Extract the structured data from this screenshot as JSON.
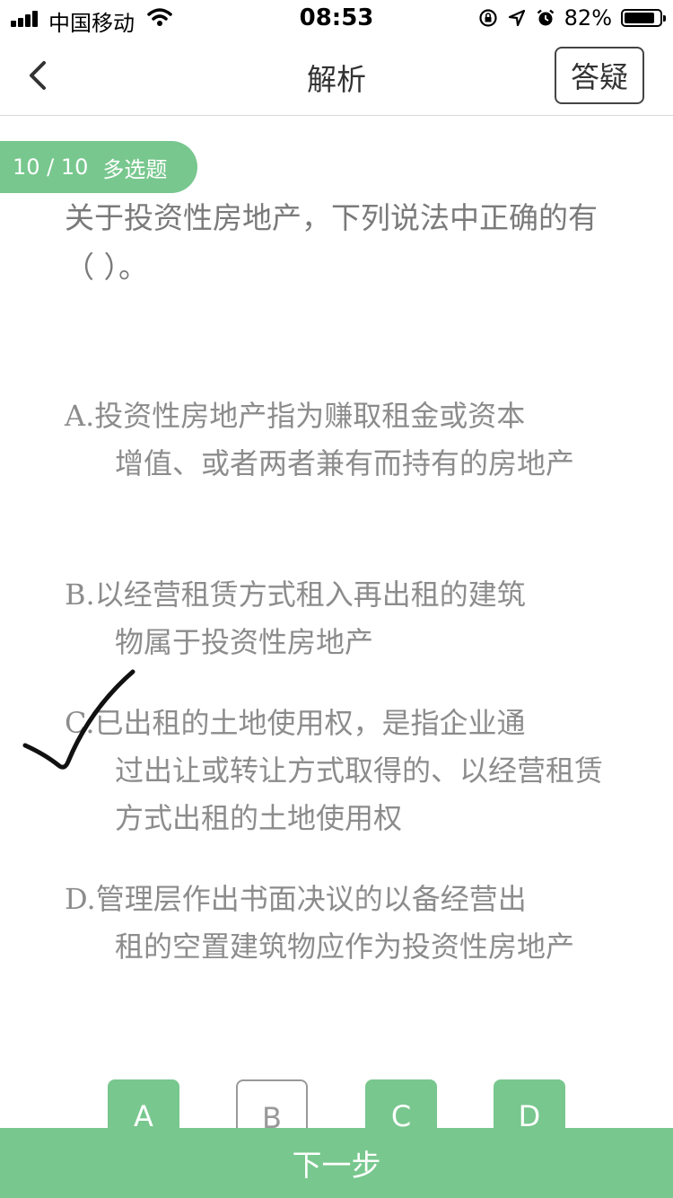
{
  "status_bar": {
    "carrier": "中国移动",
    "time": "08:53",
    "battery_percent": "82%",
    "battery_level": 0.82,
    "icons": [
      "signal-icon",
      "wifi-icon",
      "rotation-lock-icon",
      "location-icon",
      "alarm-icon",
      "battery-icon"
    ]
  },
  "nav": {
    "title": "解析",
    "ask_button": "答疑",
    "back_icon": "chevron-left-icon"
  },
  "question": {
    "progress": "10 / 10",
    "type": "多选题",
    "text": "关于投资性房地产，下列说法中正确的有（ ）。"
  },
  "options": [
    {
      "letter": "A.",
      "line1": "投资性房地产指为赚取租金或资本",
      "rest": "增值、或者两者兼有而持有的房地产"
    },
    {
      "letter": "B.",
      "line1": "以经营租赁方式租入再出租的建筑",
      "rest": "物属于投资性房地产"
    },
    {
      "letter": "C.",
      "line1": "已出租的土地使用权，是指企业通",
      "rest": "过出让或转让方式取得的、以经营租赁方式出租的土地使用权"
    },
    {
      "letter": "D.",
      "line1": "管理层作出书面决议的以备经营出",
      "rest": "租的空置建筑物应作为投资性房地产"
    }
  ],
  "answer_buttons": [
    {
      "label": "A",
      "selected": true
    },
    {
      "label": "B",
      "selected": false
    },
    {
      "label": "C",
      "selected": true
    },
    {
      "label": "D",
      "selected": true
    }
  ],
  "next_button": "下一步",
  "colors": {
    "accent": "#78c78e",
    "text_muted": "#8c8c8c"
  }
}
